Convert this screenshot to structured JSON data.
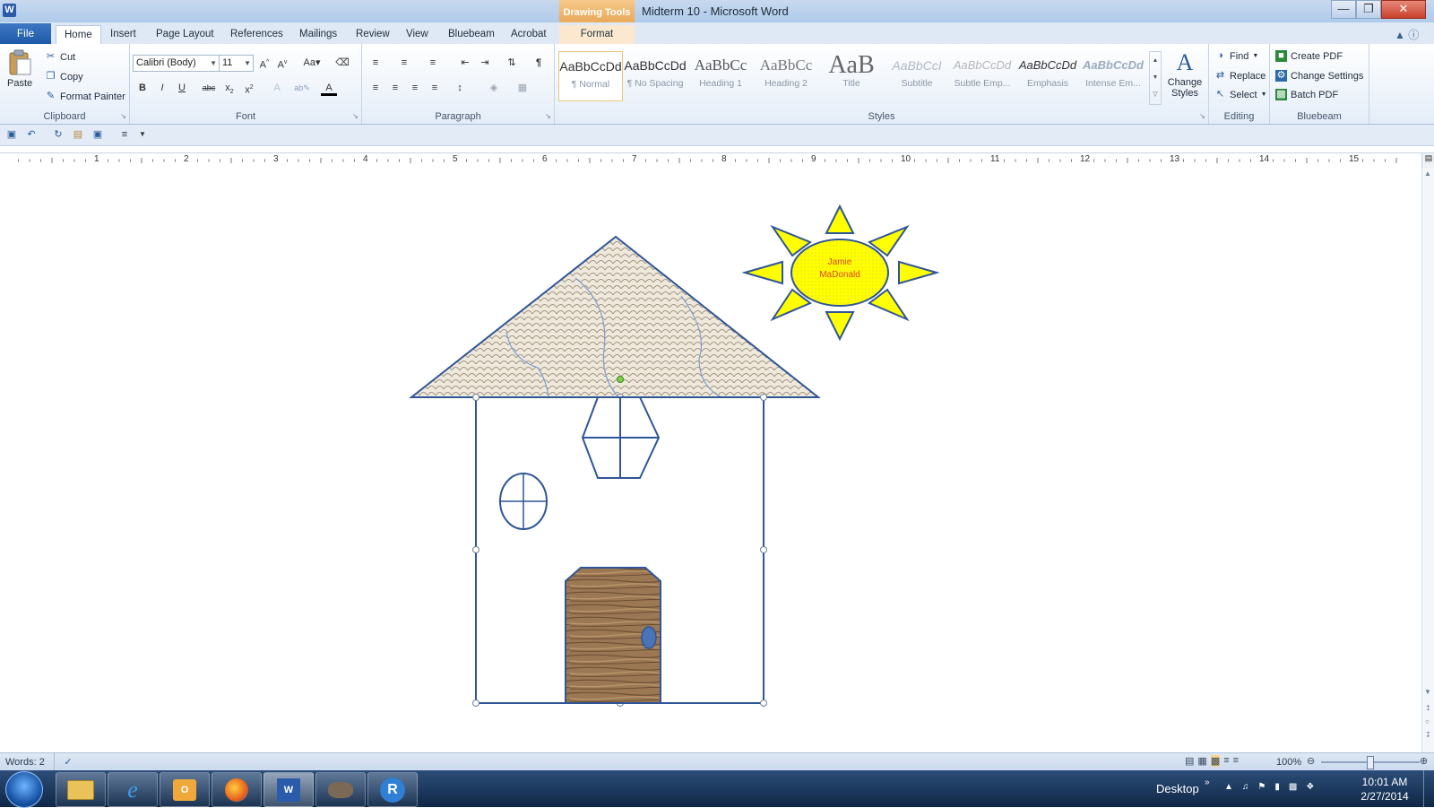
{
  "window": {
    "app_letter": "W",
    "title": "Midterm 10  -  Microsoft Word",
    "context_tab_group": "Drawing Tools"
  },
  "tabs": {
    "file": "File",
    "items": [
      "Home",
      "Insert",
      "Page Layout",
      "References",
      "Mailings",
      "Review",
      "View",
      "Bluebeam",
      "Acrobat"
    ],
    "context_tab": "Format"
  },
  "clipboard": {
    "paste": "Paste",
    "cut": "Cut",
    "copy": "Copy",
    "format_painter": "Format Painter",
    "group_label": "Clipboard"
  },
  "font": {
    "family": "Calibri (Body)",
    "size": "11",
    "group_label": "Font"
  },
  "paragraph": {
    "group_label": "Paragraph"
  },
  "styles": {
    "group_label": "Styles",
    "items": [
      {
        "sample": "AaBbCcDd",
        "name": "¶ Normal"
      },
      {
        "sample": "AaBbCcDd",
        "name": "¶ No Spacing"
      },
      {
        "sample": "AaBbCc",
        "name": "Heading 1"
      },
      {
        "sample": "AaBbCc",
        "name": "Heading 2"
      },
      {
        "sample": "AaB",
        "name": "Title"
      },
      {
        "sample": "AaBbCcI",
        "name": "Subtitle"
      },
      {
        "sample": "AaBbCcDd",
        "name": "Subtle Emp..."
      },
      {
        "sample": "AaBbCcDd",
        "name": "Emphasis"
      },
      {
        "sample": "AaBbCcDd",
        "name": "Intense Em..."
      }
    ],
    "change_styles": "Change Styles"
  },
  "editing": {
    "find": "Find",
    "replace": "Replace",
    "select": "Select",
    "group_label": "Editing"
  },
  "bluebeam": {
    "create_pdf": "Create PDF",
    "change_settings": "Change Settings",
    "batch_pdf": "Batch PDF",
    "group_label": "Bluebeam"
  },
  "ruler": {
    "numbers": [
      "1",
      "2",
      "3",
      "4",
      "5",
      "6",
      "7",
      "8",
      "9",
      "10",
      "11",
      "12",
      "13",
      "14",
      "15"
    ]
  },
  "drawing": {
    "sun_text_line1": "Jamie",
    "sun_text_line2": "MaDonald",
    "colors": {
      "outline": "#2f5597",
      "sun_fill": "#ffff00",
      "sun_text": "#e0442b",
      "door": "#8b6a48",
      "roof_fill": "#e9e1d3"
    }
  },
  "status": {
    "words": "Words: 2",
    "zoom": "100%"
  },
  "taskbar": {
    "desktop": "Desktop",
    "time": "10:01 AM",
    "date": "2/27/2014"
  }
}
